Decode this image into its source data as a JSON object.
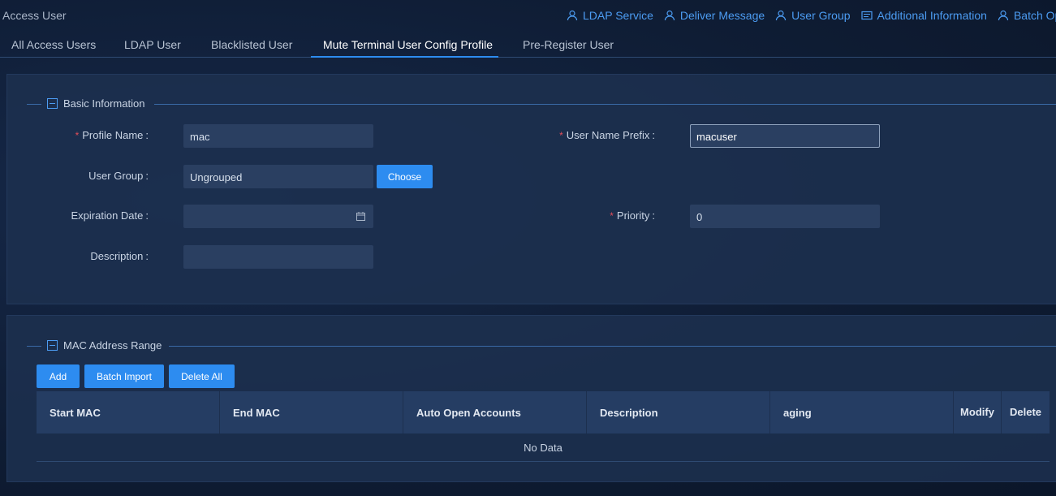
{
  "app_title": "Access User",
  "top_links": [
    {
      "label": "LDAP Service",
      "icon": "user-icon"
    },
    {
      "label": "Deliver Message",
      "icon": "user-icon"
    },
    {
      "label": "User Group",
      "icon": "user-icon"
    },
    {
      "label": "Additional Information",
      "icon": "list-card-icon"
    },
    {
      "label": "Batch Oper",
      "icon": "user-icon"
    }
  ],
  "tabs": [
    {
      "label": "All Access Users"
    },
    {
      "label": "LDAP User"
    },
    {
      "label": "Blacklisted User"
    },
    {
      "label": "Mute Terminal User Config Profile",
      "active": true
    },
    {
      "label": "Pre-Register User"
    }
  ],
  "basic_info": {
    "title": "Basic Information",
    "profile_name": {
      "label": "Profile Name",
      "value": "mac",
      "required": "*"
    },
    "user_name_prefix": {
      "label": "User Name Prefix",
      "value": "macuser",
      "required": "*"
    },
    "user_group": {
      "label": "User Group",
      "value": "Ungrouped",
      "button": "Choose"
    },
    "expiration_date": {
      "label": "Expiration Date",
      "value": ""
    },
    "priority": {
      "label": "Priority",
      "value": "0",
      "required": "*"
    },
    "description": {
      "label": "Description",
      "value": ""
    }
  },
  "mac_range": {
    "title": "MAC Address Range",
    "buttons": {
      "add": "Add",
      "batch_import": "Batch Import",
      "delete_all": "Delete All"
    },
    "columns": [
      "Start MAC",
      "End MAC",
      "Auto Open Accounts",
      "Description",
      "aging",
      "Modify",
      "Delete"
    ],
    "empty_text": "No Data"
  },
  "colors": {
    "accent": "#2d8cf0",
    "link": "#4c9cf2",
    "required": "#e34d59",
    "panel": "#1d304f"
  }
}
